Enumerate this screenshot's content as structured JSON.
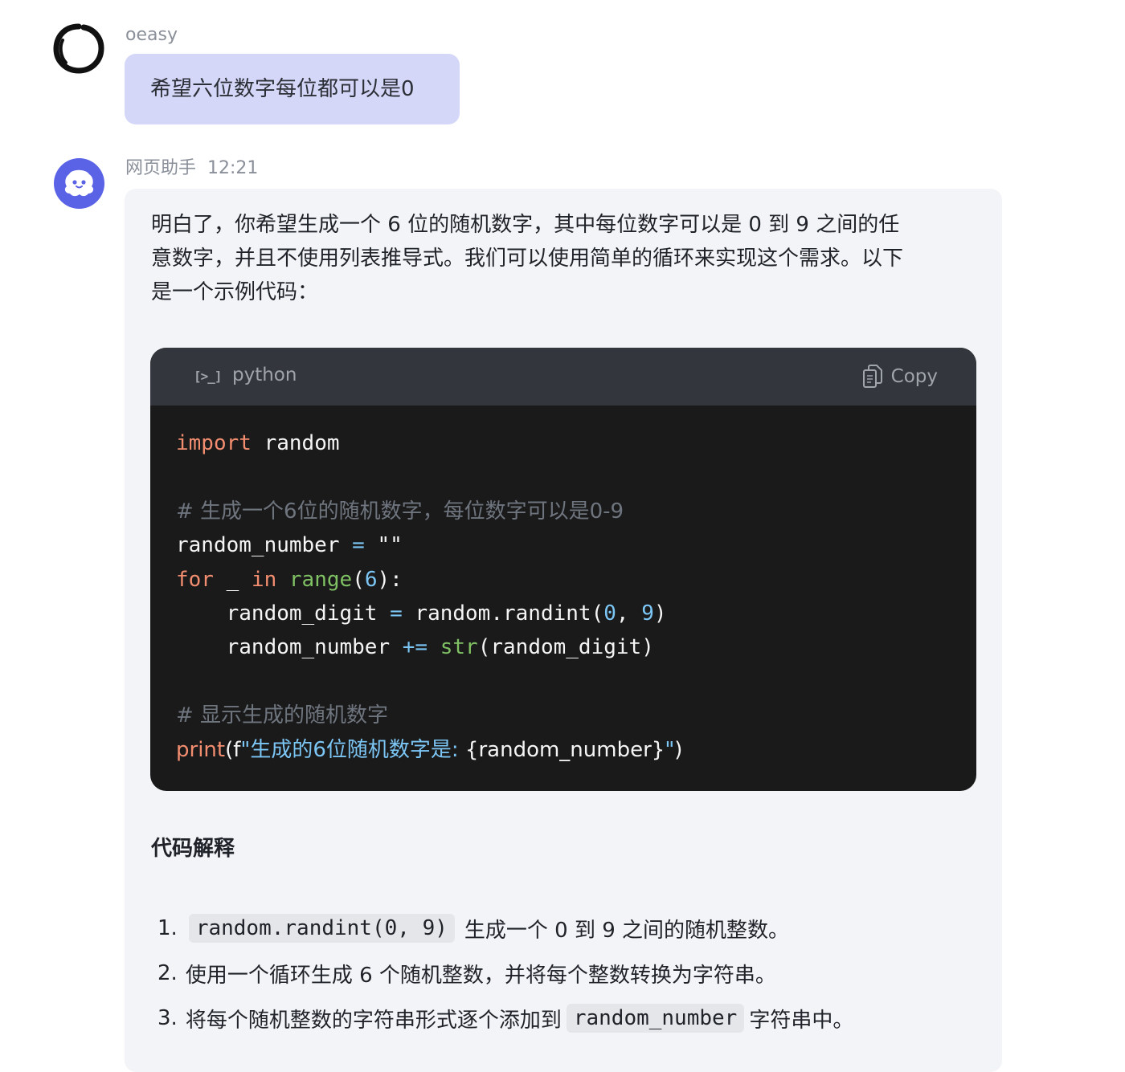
{
  "user": {
    "name": "oeasy",
    "message": "希望六位数字每位都可以是0"
  },
  "assistant": {
    "name": "网页助手",
    "time": "12:21",
    "intro_lines": [
      "明白了，你希望生成一个 6 位的随机数字，其中每位数字可以是 0 到 9 之间的任",
      "意数字，并且不使用列表推导式。我们可以使用简单的循环来实现这个需求。以下",
      "是一个示例代码："
    ],
    "code": {
      "language": "python",
      "lang_icon": "[>_]",
      "copy_label": "Copy",
      "lines": [
        "import random",
        "",
        "# 生成一个6位的随机数字，每位数字可以是0-9",
        "random_number = \"\"",
        "for _ in range(6):",
        "    random_digit = random.randint(0, 9)",
        "    random_number += str(random_digit)",
        "",
        "# 显示生成的随机数字",
        "print(f\"生成的6位随机数字是: {random_number}\")"
      ]
    },
    "explanation_title": "代码解释",
    "explanation": [
      {
        "num": "1.",
        "code": "random.randint(0, 9)",
        "text": "生成一个 0 到 9 之间的随机整数。"
      },
      {
        "num": "2.",
        "text": "使用一个循环生成 6 个随机整数，并将每个整数转换为字符串。"
      },
      {
        "num": "3.",
        "pre": "将每个随机整数的字符串形式逐个添加到",
        "code": "random_number",
        "text": "字符串中。"
      }
    ]
  },
  "colors": {
    "user_bubble": "#d4d7f8",
    "bot_bubble": "#f3f4f7",
    "bot_avatar": "#5a62e6",
    "code_bg": "#1a1a1b",
    "code_header": "#33363d",
    "keyword": "#f38d70",
    "builtin": "#7fc163",
    "number": "#7cc6f5"
  }
}
